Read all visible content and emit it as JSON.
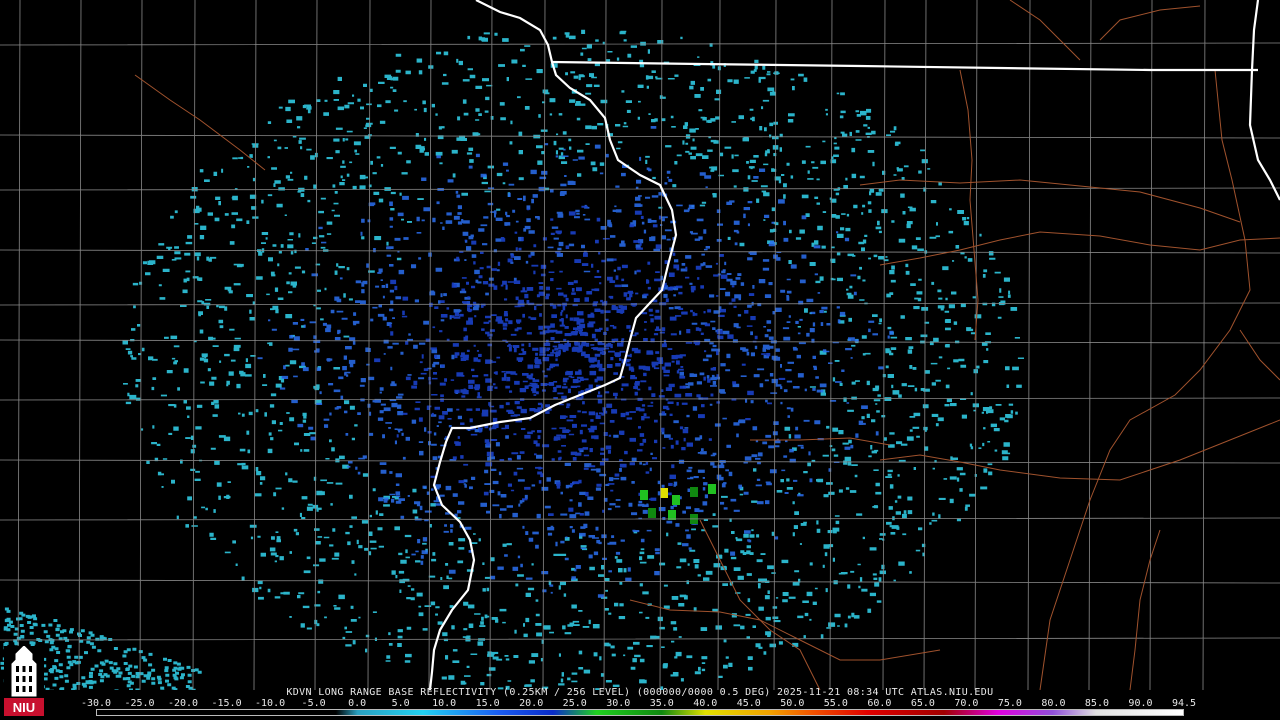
{
  "header": {
    "title": "KDVN LONG RANGE BASE REFLECTIVITY (0.25KM / 256 LEVEL) (000000/0000 0.5 DEG) 2025-11-21 08:34 UTC  ATLAS.NIU.EDU"
  },
  "logo": {
    "text": "NIU",
    "icon": "niu-tower-logo"
  },
  "scale": {
    "labels": [
      "-30.0",
      "-25.0",
      "-20.0",
      "-15.0",
      "-10.0",
      "-5.0",
      "0.0",
      "5.0",
      "10.0",
      "15.0",
      "20.0",
      "25.0",
      "30.0",
      "35.0",
      "40.0",
      "45.0",
      "50.0",
      "55.0",
      "60.0",
      "65.0",
      "70.0",
      "75.0",
      "80.0",
      "85.0",
      "90.0",
      "94.5"
    ],
    "colors": [
      "#000000",
      "#000000",
      "#000000",
      "#000000",
      "#000000",
      "#000000",
      "#000000",
      "#3aa7c8",
      "#28c8e8",
      "#1a5cf0",
      "#0a2cc8",
      "#20c020",
      "#108810",
      "#d8d000",
      "#f0a000",
      "#f06000",
      "#e00000",
      "#b00000",
      "#880000",
      "#e000e0",
      "#9050d8",
      "#e0e0e0",
      "#f8f8f8",
      "#ffffff",
      "#ffffff",
      "#ffffff"
    ]
  },
  "colors": {
    "background": "#000000",
    "state_border": "#ffffff",
    "county_line": "#8a8a8a",
    "highway": "#a0522d",
    "echo_light": "#30c8e0",
    "echo_mid": "#2a6ef0",
    "echo_dark": "#1a40c8"
  }
}
